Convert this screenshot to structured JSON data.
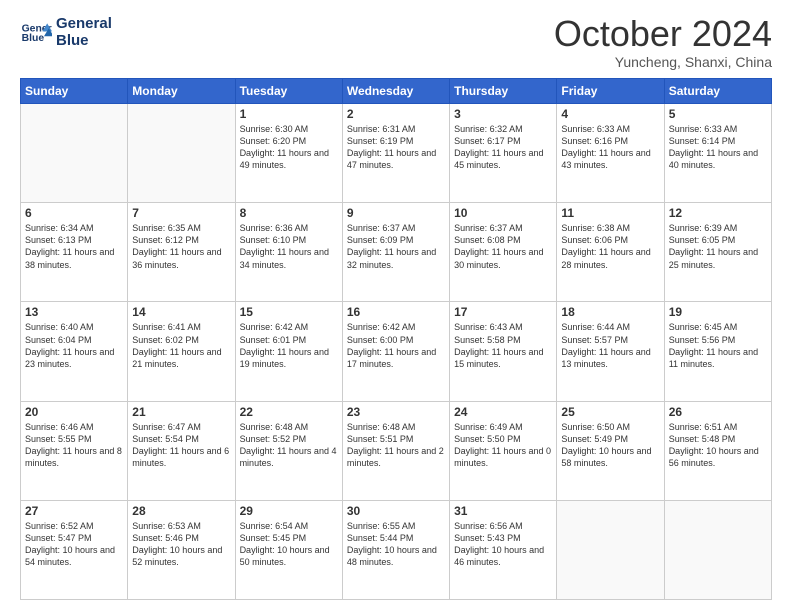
{
  "header": {
    "logo_line1": "General",
    "logo_line2": "Blue",
    "month": "October 2024",
    "location": "Yuncheng, Shanxi, China"
  },
  "weekdays": [
    "Sunday",
    "Monday",
    "Tuesday",
    "Wednesday",
    "Thursday",
    "Friday",
    "Saturday"
  ],
  "weeks": [
    [
      {
        "day": "",
        "info": ""
      },
      {
        "day": "",
        "info": ""
      },
      {
        "day": "1",
        "info": "Sunrise: 6:30 AM\nSunset: 6:20 PM\nDaylight: 11 hours and 49 minutes."
      },
      {
        "day": "2",
        "info": "Sunrise: 6:31 AM\nSunset: 6:19 PM\nDaylight: 11 hours and 47 minutes."
      },
      {
        "day": "3",
        "info": "Sunrise: 6:32 AM\nSunset: 6:17 PM\nDaylight: 11 hours and 45 minutes."
      },
      {
        "day": "4",
        "info": "Sunrise: 6:33 AM\nSunset: 6:16 PM\nDaylight: 11 hours and 43 minutes."
      },
      {
        "day": "5",
        "info": "Sunrise: 6:33 AM\nSunset: 6:14 PM\nDaylight: 11 hours and 40 minutes."
      }
    ],
    [
      {
        "day": "6",
        "info": "Sunrise: 6:34 AM\nSunset: 6:13 PM\nDaylight: 11 hours and 38 minutes."
      },
      {
        "day": "7",
        "info": "Sunrise: 6:35 AM\nSunset: 6:12 PM\nDaylight: 11 hours and 36 minutes."
      },
      {
        "day": "8",
        "info": "Sunrise: 6:36 AM\nSunset: 6:10 PM\nDaylight: 11 hours and 34 minutes."
      },
      {
        "day": "9",
        "info": "Sunrise: 6:37 AM\nSunset: 6:09 PM\nDaylight: 11 hours and 32 minutes."
      },
      {
        "day": "10",
        "info": "Sunrise: 6:37 AM\nSunset: 6:08 PM\nDaylight: 11 hours and 30 minutes."
      },
      {
        "day": "11",
        "info": "Sunrise: 6:38 AM\nSunset: 6:06 PM\nDaylight: 11 hours and 28 minutes."
      },
      {
        "day": "12",
        "info": "Sunrise: 6:39 AM\nSunset: 6:05 PM\nDaylight: 11 hours and 25 minutes."
      }
    ],
    [
      {
        "day": "13",
        "info": "Sunrise: 6:40 AM\nSunset: 6:04 PM\nDaylight: 11 hours and 23 minutes."
      },
      {
        "day": "14",
        "info": "Sunrise: 6:41 AM\nSunset: 6:02 PM\nDaylight: 11 hours and 21 minutes."
      },
      {
        "day": "15",
        "info": "Sunrise: 6:42 AM\nSunset: 6:01 PM\nDaylight: 11 hours and 19 minutes."
      },
      {
        "day": "16",
        "info": "Sunrise: 6:42 AM\nSunset: 6:00 PM\nDaylight: 11 hours and 17 minutes."
      },
      {
        "day": "17",
        "info": "Sunrise: 6:43 AM\nSunset: 5:58 PM\nDaylight: 11 hours and 15 minutes."
      },
      {
        "day": "18",
        "info": "Sunrise: 6:44 AM\nSunset: 5:57 PM\nDaylight: 11 hours and 13 minutes."
      },
      {
        "day": "19",
        "info": "Sunrise: 6:45 AM\nSunset: 5:56 PM\nDaylight: 11 hours and 11 minutes."
      }
    ],
    [
      {
        "day": "20",
        "info": "Sunrise: 6:46 AM\nSunset: 5:55 PM\nDaylight: 11 hours and 8 minutes."
      },
      {
        "day": "21",
        "info": "Sunrise: 6:47 AM\nSunset: 5:54 PM\nDaylight: 11 hours and 6 minutes."
      },
      {
        "day": "22",
        "info": "Sunrise: 6:48 AM\nSunset: 5:52 PM\nDaylight: 11 hours and 4 minutes."
      },
      {
        "day": "23",
        "info": "Sunrise: 6:48 AM\nSunset: 5:51 PM\nDaylight: 11 hours and 2 minutes."
      },
      {
        "day": "24",
        "info": "Sunrise: 6:49 AM\nSunset: 5:50 PM\nDaylight: 11 hours and 0 minutes."
      },
      {
        "day": "25",
        "info": "Sunrise: 6:50 AM\nSunset: 5:49 PM\nDaylight: 10 hours and 58 minutes."
      },
      {
        "day": "26",
        "info": "Sunrise: 6:51 AM\nSunset: 5:48 PM\nDaylight: 10 hours and 56 minutes."
      }
    ],
    [
      {
        "day": "27",
        "info": "Sunrise: 6:52 AM\nSunset: 5:47 PM\nDaylight: 10 hours and 54 minutes."
      },
      {
        "day": "28",
        "info": "Sunrise: 6:53 AM\nSunset: 5:46 PM\nDaylight: 10 hours and 52 minutes."
      },
      {
        "day": "29",
        "info": "Sunrise: 6:54 AM\nSunset: 5:45 PM\nDaylight: 10 hours and 50 minutes."
      },
      {
        "day": "30",
        "info": "Sunrise: 6:55 AM\nSunset: 5:44 PM\nDaylight: 10 hours and 48 minutes."
      },
      {
        "day": "31",
        "info": "Sunrise: 6:56 AM\nSunset: 5:43 PM\nDaylight: 10 hours and 46 minutes."
      },
      {
        "day": "",
        "info": ""
      },
      {
        "day": "",
        "info": ""
      }
    ]
  ]
}
